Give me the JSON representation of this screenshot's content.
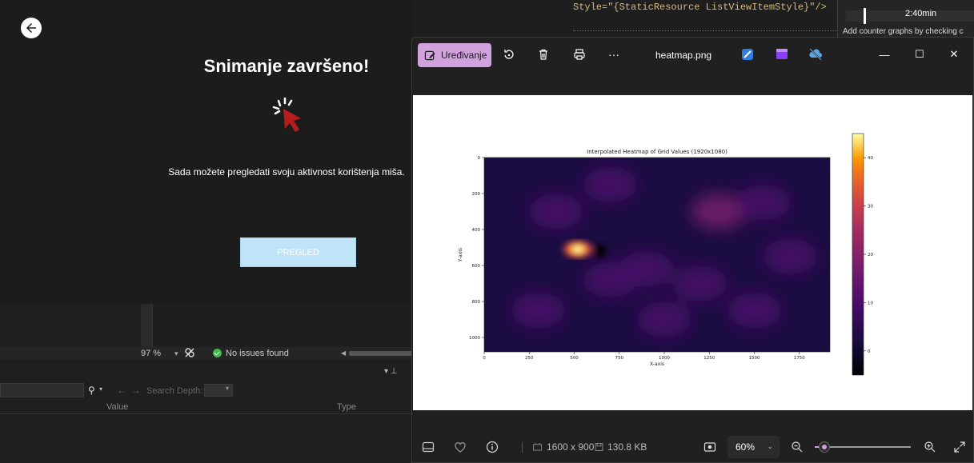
{
  "left_app": {
    "title": "Snimanje završeno!",
    "subtitle": "Sada možete pregledati svoju aktivnost korištenja miša.",
    "review_button": "PREGLED"
  },
  "ide": {
    "zoom": "97 %",
    "issues": "No issues found",
    "search_depth_label": "Search Depth:",
    "columns": {
      "value": "Value",
      "type": "Type"
    },
    "code_line": "Style=\"{StaticResource ListViewItemStyle}\"/>",
    "profiler_time": "2:40min",
    "profiler_hint": "Add counter graphs by checking c"
  },
  "viewer": {
    "edit_label": "Uređivanje",
    "file_name": "heatmap.png",
    "dimensions": "1600 x 900",
    "file_size": "130.8 KB",
    "zoom_label": "60%",
    "zoom_value": 0.1,
    "accent": "#d1a2dd"
  },
  "icons": {
    "back": "back-arrow-icon",
    "cursor": "mouse-click-icon",
    "edit": "edit-image-icon",
    "rotate": "rotate-icon",
    "delete": "delete-icon",
    "print": "print-icon",
    "more": "more-icon",
    "minimize": "minimize-icon",
    "maximize": "maximize-icon",
    "close": "close-icon"
  },
  "chart_data": {
    "type": "heatmap",
    "title": "Interpolated Heatmap of Grid Values (1920x1080)",
    "xlabel": "X-axis",
    "ylabel": "Y-axis",
    "xlim": [
      0,
      1920
    ],
    "ylim": [
      1080,
      0
    ],
    "x_ticks": [
      "0",
      "250",
      "500",
      "750",
      "1000",
      "1250",
      "1500",
      "1750"
    ],
    "y_ticks": [
      "0",
      "200",
      "400",
      "600",
      "800",
      "1000"
    ],
    "colorbar_ticks": [
      "40",
      "30",
      "20",
      "10",
      "0"
    ],
    "colorbar_range": [
      -5,
      45
    ],
    "colormap": "inferno",
    "hotspots": [
      {
        "x": 520,
        "y": 510,
        "value": 44
      },
      {
        "x": 1300,
        "y": 300,
        "value": 11
      },
      {
        "x": 1550,
        "y": 250,
        "value": 10
      },
      {
        "x": 900,
        "y": 620,
        "value": 9
      },
      {
        "x": 300,
        "y": 850,
        "value": 8
      },
      {
        "x": 700,
        "y": 680,
        "value": 9
      },
      {
        "x": 1200,
        "y": 700,
        "value": 8
      },
      {
        "x": 400,
        "y": 300,
        "value": 7
      },
      {
        "x": 1700,
        "y": 550,
        "value": 8
      },
      {
        "x": 1000,
        "y": 900,
        "value": 7
      },
      {
        "x": 1500,
        "y": 850,
        "value": 6
      },
      {
        "x": 700,
        "y": 150,
        "value": 7
      }
    ]
  }
}
